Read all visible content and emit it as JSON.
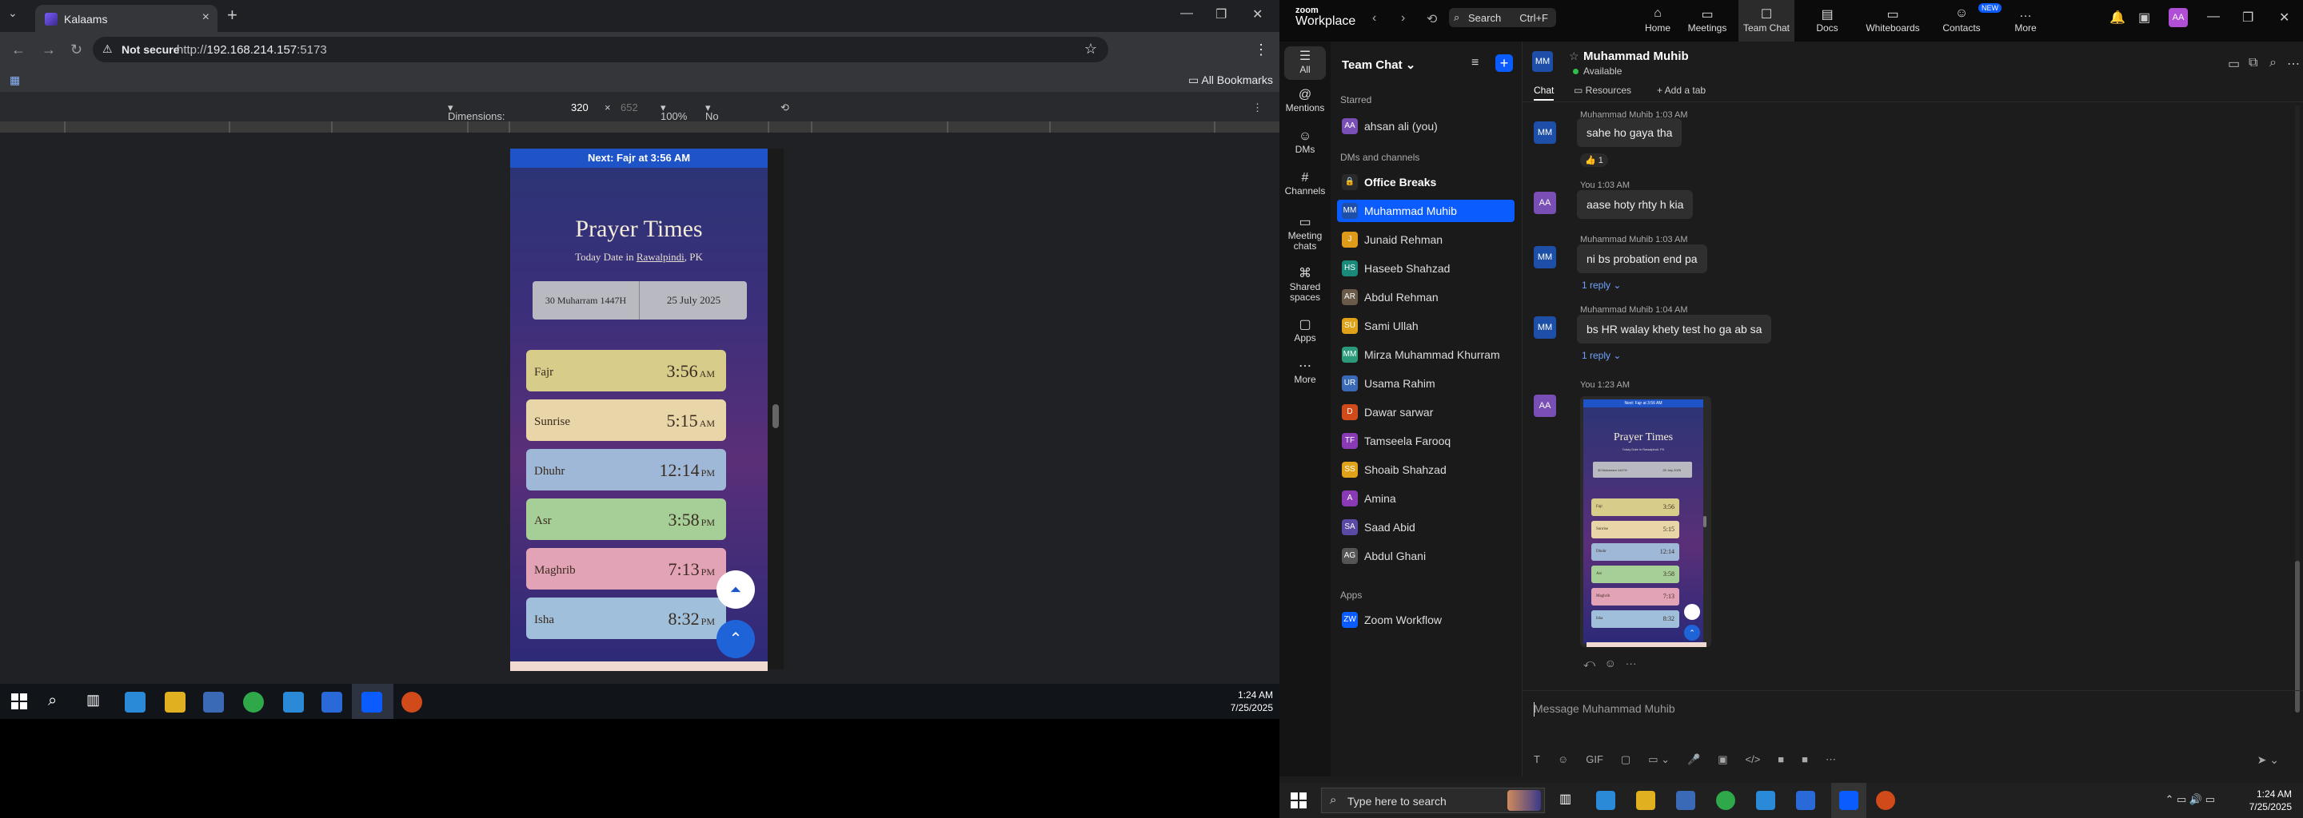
{
  "left_browser": {
    "tab_title": "Kalaams",
    "address": {
      "security_label": "Not secure",
      "url_prefix": "http://",
      "url_host": "192.168.214.157",
      "url_port": ":5173"
    },
    "bookmarks_label": "All Bookmarks",
    "devtools": {
      "dimensions_label": "Dimensions: Responsive",
      "width_value": "320",
      "times": "×",
      "height_value": "652",
      "zoom": "100%",
      "throttling": "No throttling"
    }
  },
  "prayer_app": {
    "next_banner": "Next: Fajr at 3:56 AM",
    "title": "Prayer Times",
    "date_prefix": "Today Date in ",
    "location": "Rawalpindi",
    "country": ", PK",
    "hijri_date": "30 Muharram 1447H",
    "gregorian_date": "25 July 2025",
    "prayers": [
      {
        "name": "Fajr",
        "time": "3:56",
        "ampm": "AM",
        "color": "#d8cc8a"
      },
      {
        "name": "Sunrise",
        "time": "5:15",
        "ampm": "AM",
        "color": "#e8d6a8"
      },
      {
        "name": "Dhuhr",
        "time": "12:14",
        "ampm": "PM",
        "color": "#9fb8d8"
      },
      {
        "name": "Asr",
        "time": "3:58",
        "ampm": "PM",
        "color": "#a6cf98"
      },
      {
        "name": "Maghrib",
        "time": "7:13",
        "ampm": "PM",
        "color": "#e3a3b6"
      },
      {
        "name": "Isha",
        "time": "8:32",
        "ampm": "PM",
        "color": "#9fbfda"
      }
    ]
  },
  "left_taskbar": {
    "time": "1:24 AM",
    "date": "7/25/2025"
  },
  "zoom": {
    "brand_top": "zoom",
    "brand_bottom": "Workplace",
    "search_label": "Search",
    "search_shortcut": "Ctrl+F",
    "new_badge": "NEW",
    "user_initials": "AA",
    "tabs": [
      {
        "label": "Home",
        "icon": "⌂"
      },
      {
        "label": "Meetings",
        "icon": "▭"
      },
      {
        "label": "Team Chat",
        "icon": "☐"
      },
      {
        "label": "Docs",
        "icon": "▤"
      },
      {
        "label": "Whiteboards",
        "icon": "▭"
      },
      {
        "label": "Contacts",
        "icon": "☺"
      },
      {
        "label": "More",
        "icon": "…"
      }
    ],
    "rail": [
      {
        "label": "All",
        "icon": "☰"
      },
      {
        "label": "Mentions",
        "icon": "@"
      },
      {
        "label": "DMs",
        "icon": "☺"
      },
      {
        "label": "Channels",
        "icon": "#"
      },
      {
        "label": "Meeting chats",
        "icon": "▭"
      },
      {
        "label": "Shared spaces",
        "icon": "⌘"
      },
      {
        "label": "Apps",
        "icon": "▢"
      },
      {
        "label": "More",
        "icon": "⋯"
      }
    ],
    "list": {
      "title": "Team Chat ⌄",
      "starred_label": "Starred",
      "starred": [
        {
          "name": "ahsan ali (you)",
          "initials": "AA",
          "color": "#7a4fb5"
        }
      ],
      "dm_label": "DMs and channels",
      "items": [
        {
          "name": "Office Breaks",
          "initials": "🔒",
          "color": "#2a2a2a",
          "bold": true
        },
        {
          "name": "Muhammad Muhib",
          "initials": "MM",
          "color": "#1e4fa8",
          "selected": true
        },
        {
          "name": "Junaid Rehman",
          "initials": "J",
          "color": "#e09a1a"
        },
        {
          "name": "Haseeb Shahzad",
          "initials": "HS",
          "color": "#1a8a7a"
        },
        {
          "name": "Abdul Rehman",
          "initials": "AR",
          "color": "#6a5a4a"
        },
        {
          "name": "Sami Ullah",
          "initials": "SU",
          "color": "#e0a21a"
        },
        {
          "name": "Mirza Muhammad Khurram",
          "initials": "MM",
          "color": "#2a9a7a"
        },
        {
          "name": "Usama Rahim",
          "initials": "UR",
          "color": "#3a6ab5"
        },
        {
          "name": "Dawar sarwar",
          "initials": "D",
          "color": "#d04a1a"
        },
        {
          "name": "Tamseela Farooq",
          "initials": "TF",
          "color": "#8a3ab5"
        },
        {
          "name": "Shoaib Shahzad",
          "initials": "SS",
          "color": "#e0a21a"
        },
        {
          "name": "Amina",
          "initials": "A",
          "color": "#8a3ab5"
        },
        {
          "name": "Saad Abid",
          "initials": "SA",
          "color": "#5a4aa5"
        },
        {
          "name": "Abdul Ghani",
          "initials": "AG",
          "color": "#555"
        }
      ],
      "apps_label": "Apps",
      "apps": [
        {
          "name": "Zoom Workflow",
          "initials": "ZW",
          "color": "#0b5cff"
        }
      ]
    },
    "chat": {
      "name": "Muhammad Muhib",
      "initials": "MM",
      "status": "Available",
      "tab_chat": "Chat",
      "tab_resources": "Resources",
      "tab_add": "+ Add a tab",
      "messages": [
        {
          "meta": "Muhammad Muhib  1:03 AM",
          "text": "sahe ho gaya tha",
          "initials": "MM",
          "reaction": "👍 1"
        },
        {
          "meta": "You  1:03 AM",
          "text": "aase hoty rhty h kia",
          "initials": "AA"
        },
        {
          "meta": "Muhammad Muhib  1:03 AM",
          "text": "ni bs probation end pa",
          "initials": "MM",
          "reply": "1 reply ⌄"
        },
        {
          "meta": "Muhammad Muhib  1:04 AM",
          "text": "bs HR walay khety test ho ga ab sa",
          "initials": "MM",
          "reply": "1 reply ⌄"
        },
        {
          "meta": "You  1:23 AM",
          "initials": "AA"
        }
      ],
      "composer_placeholder": "Message Muhammad Muhib",
      "composer_tools": [
        "T",
        "☺",
        "GIF",
        "▢",
        "▭ ⌄",
        "🎤",
        "▣",
        "</>",
        "■",
        "■",
        "⋯"
      ]
    }
  },
  "right_taskbar": {
    "search_placeholder": "Type here to search",
    "time": "1:24 AM",
    "date": "7/25/2025"
  }
}
